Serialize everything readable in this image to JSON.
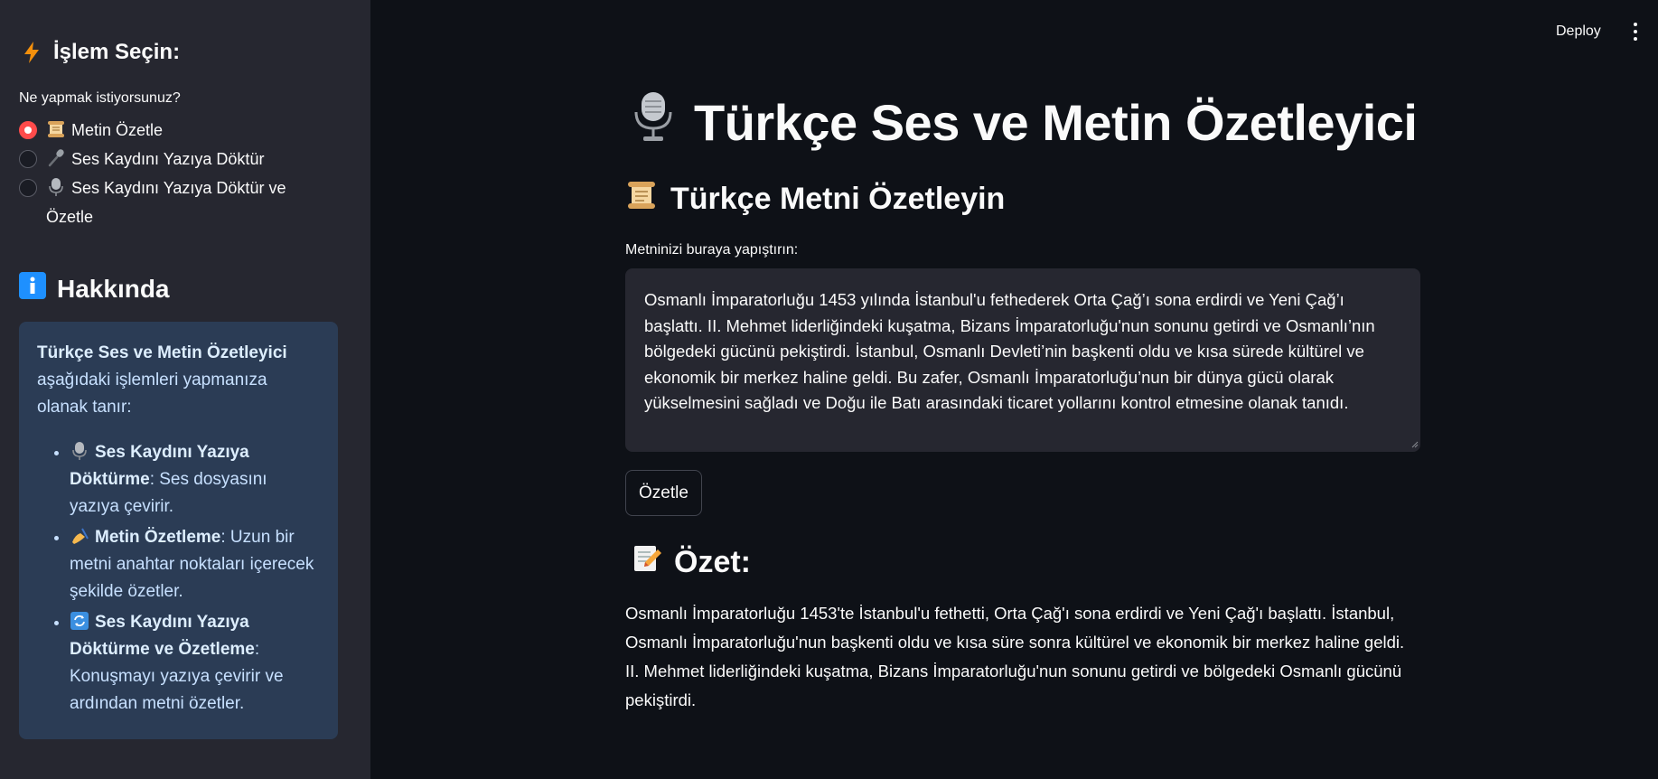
{
  "sidebar": {
    "title": "İşlem Seçin:",
    "title_icon": "lightning-icon",
    "radio_label": "Ne yapmak istiyorsunuz?",
    "options": [
      {
        "label": "Metin Özetle",
        "icon": "scroll-icon",
        "selected": true
      },
      {
        "label": "Ses Kaydını Yazıya Döktür",
        "icon": "microphone-icon",
        "selected": false
      },
      {
        "label": "Ses Kaydını Yazıya Döktür ve Özetle",
        "icon": "studio-mic-icon",
        "selected": false
      }
    ],
    "about": {
      "title": "Hakkında",
      "title_icon": "info-icon",
      "intro_bold": "Türkçe Ses ve Metin Özetleyici",
      "intro_rest": " aşağıdaki işlemleri yapmanıza olanak tanır:",
      "items": [
        {
          "icon": "studio-mic-icon",
          "bold": "Ses Kaydını Yazıya Döktürme",
          "text": ": Ses dosyasını yazıya çevirir."
        },
        {
          "icon": "writing-hand-icon",
          "bold": "Metin Özetleme",
          "text": ": Uzun bir metni anahtar noktaları içerecek şekilde özetler."
        },
        {
          "icon": "refresh-icon",
          "bold": "Ses Kaydını Yazıya Döktürme ve Özetleme",
          "text": ": Konuşmayı yazıya çevirir ve ardından metni özetler."
        }
      ]
    }
  },
  "header": {
    "deploy_label": "Deploy",
    "menu_icon": "kebab-menu-icon"
  },
  "main": {
    "title": "Türkçe Ses ve Metin Özetleyici",
    "title_icon": "studio-mic-icon",
    "subtitle": "Türkçe Metni Özetleyin",
    "subtitle_icon": "scroll-icon",
    "textarea_label": "Metninizi buraya yapıştırın:",
    "textarea_value": "Osmanlı İmparatorluğu 1453 yılında İstanbul'u fethederek Orta Çağ’ı sona erdirdi ve Yeni Çağ’ı başlattı. II. Mehmet liderliğindeki kuşatma, Bizans İmparatorluğu'nun sonunu getirdi ve Osmanlı’nın bölgedeki gücünü pekiştirdi. İstanbul, Osmanlı Devleti’nin başkenti oldu ve kısa sürede kültürel ve ekonomik bir merkez haline geldi. Bu zafer, Osmanlı İmparatorluğu’nun bir dünya gücü olarak yükselmesini sağladı ve Doğu ile Batı arasındaki ticaret yollarını kontrol etmesine olanak tanıdı.",
    "button_label": "Özetle",
    "result_title": "Özet:",
    "result_icon": "memo-icon",
    "result_text": "Osmanlı İmparatorluğu 1453'te İstanbul'u fethetti, Orta Çağ'ı sona erdirdi ve Yeni Çağ'ı başlattı. İstanbul, Osmanlı İmparatorluğu'nun başkenti oldu ve kısa süre sonra kültürel ve ekonomik bir merkez haline geldi. II. Mehmet liderliğindeki kuşatma, Bizans İmparatorluğu'nun sonunu getirdi ve bölgedeki Osmanlı gücünü pekiştirdi."
  },
  "colors": {
    "accent": "#ff4b4b",
    "background": "#0e1117",
    "sidebar": "#262730",
    "info_box": "#2b3c55"
  }
}
